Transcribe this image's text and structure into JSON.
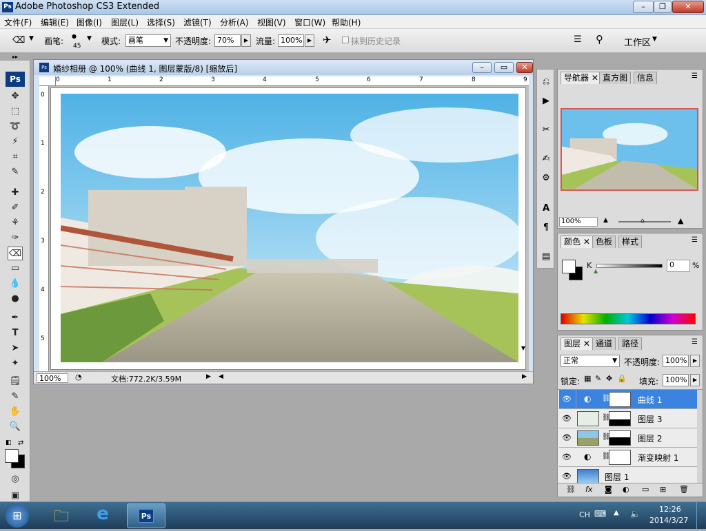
{
  "window": {
    "title": "Adobe Photoshop CS3 Extended",
    "app_icon": "Ps",
    "minimize": "–",
    "maximize": "❐",
    "close": "✕"
  },
  "menu": [
    "文件(F)",
    "编辑(E)",
    "图像(I)",
    "图层(L)",
    "选择(S)",
    "滤镜(T)",
    "分析(A)",
    "视图(V)",
    "窗口(W)",
    "帮助(H)"
  ],
  "options": {
    "brush_label": "画笔:",
    "brush_size": "45",
    "mode_label": "模式:",
    "mode_value": "画笔",
    "opacity_label": "不透明度:",
    "opacity_value": "70%",
    "flow_label": "流量:",
    "flow_value": "100%",
    "erase_history_label": "抹到历史记录",
    "workspace_label": "工作区"
  },
  "document": {
    "title": "婚纱相册 @ 100% (曲线 1, 图层蒙版/8) [缩放后]",
    "zoom": "100%",
    "doc_info": "文档:772.2K/3.59M",
    "ruler_h": [
      "0",
      "1",
      "2",
      "3",
      "4",
      "5",
      "6",
      "7",
      "8",
      "9"
    ],
    "ruler_v": [
      "0",
      "1",
      "2",
      "3",
      "4",
      "5"
    ]
  },
  "navigator": {
    "tabs": [
      "导航器",
      "直方图",
      "信息"
    ],
    "zoom": "100%"
  },
  "color_panel": {
    "tabs": [
      "颜色",
      "色板",
      "样式"
    ],
    "channel": "K",
    "value": "0",
    "unit": "%"
  },
  "layers_panel": {
    "tabs": [
      "图层",
      "通道",
      "路径"
    ],
    "blend_mode": "正常",
    "opacity_label": "不透明度:",
    "opacity_value": "100%",
    "lock_label": "锁定:",
    "fill_label": "填充:",
    "fill_value": "100%",
    "layers": [
      {
        "name": "曲线 1",
        "selected": true
      },
      {
        "name": "图层 3",
        "selected": false
      },
      {
        "name": "图层 2",
        "selected": false
      },
      {
        "name": "渐变映射 1",
        "selected": false
      },
      {
        "name": "图层 1",
        "selected": false
      }
    ]
  },
  "taskbar": {
    "lang": "CH",
    "time": "12:26",
    "date": "2014/3/27",
    "ps_label": "Ps"
  },
  "colors": {
    "selection": "#3a83e0",
    "ps_blue": "#0b3d80",
    "taskbar": "#1d3d5a"
  }
}
